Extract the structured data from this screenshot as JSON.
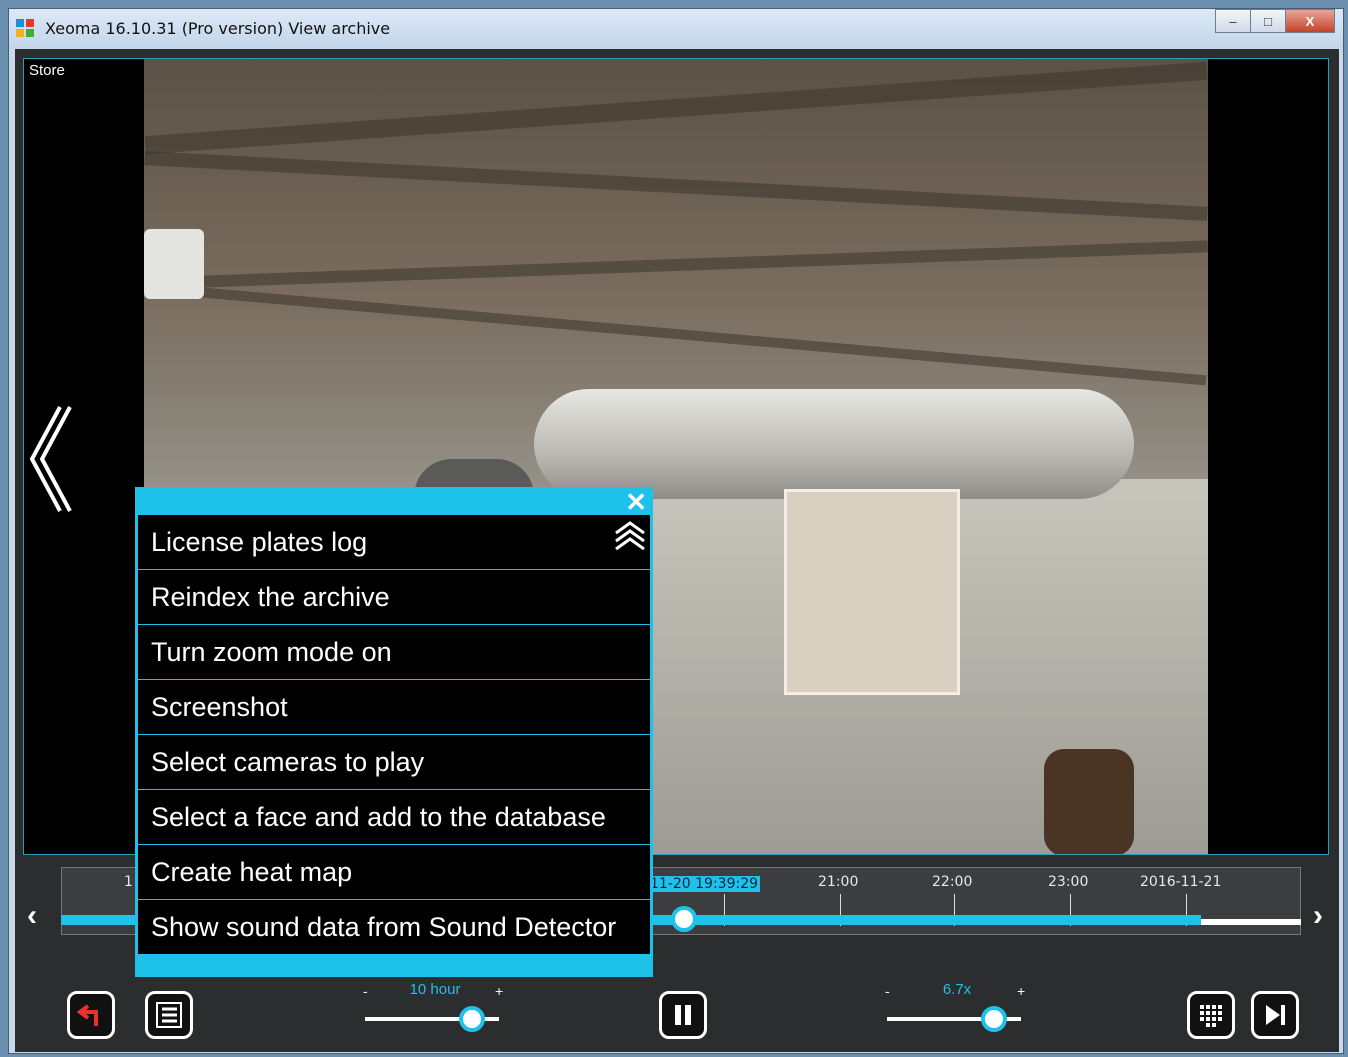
{
  "window": {
    "title": "Xeoma 16.10.31 (Pro version) View archive",
    "controls": {
      "minimize": "‒",
      "maximize": "□",
      "close": "X"
    }
  },
  "video": {
    "camera_label": "Store"
  },
  "menu": {
    "close_icon": "close-icon",
    "items": [
      "License plates log",
      "Reindex the archive",
      "Turn zoom mode on",
      "Screenshot",
      "Select cameras to play",
      "Select a face and add to the database",
      "Create heat map",
      "Show sound data from Sound Detector"
    ]
  },
  "timeline": {
    "current_time": "11-20 19:39:29",
    "ticks": [
      "21:00",
      "22:00",
      "23:00",
      "2016-11-21"
    ],
    "left_partial": "1"
  },
  "bottom_bar": {
    "zoom": {
      "minus": "-",
      "plus": "+",
      "value": "10 hour",
      "level": 0.8
    },
    "speed": {
      "minus": "-",
      "plus": "+",
      "value": "6.7x",
      "level": 0.8
    }
  },
  "colors": {
    "accent": "#1ec1ea",
    "background": "#2b2d2e"
  }
}
